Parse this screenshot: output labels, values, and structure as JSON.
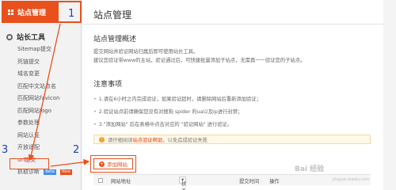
{
  "sidebar": {
    "header": "站点管理",
    "section_title": "站长工具",
    "items": [
      {
        "label": "Sitemap提交"
      },
      {
        "label": "死链提交"
      },
      {
        "label": "域名变更"
      },
      {
        "label": "匹配中文站点名"
      },
      {
        "label": "匹配网站favicon"
      },
      {
        "label": "匹配网站logo"
      },
      {
        "label": "参数处理"
      },
      {
        "label": "网站认证"
      },
      {
        "label": "开放适配"
      },
      {
        "label": "url提交"
      },
      {
        "label": "抓取诊断",
        "tags": [
          "Beta",
          "New"
        ]
      }
    ]
  },
  "main": {
    "title": "站点管理",
    "overview_heading": "站点管理概述",
    "overview_lines": [
      "提交网站并验证网站归属后即可使用站长工具。",
      "建议您验证带www的主站，验证通过后，可快捷批量添加子站点，无需再一一验证您的子站点。"
    ],
    "notes_heading": "注意事项",
    "notes": [
      "1.请在6小时之内完成验证，如果验证超时，请删除网站后重新添加验证；",
      "2.验证站点前请确保您没有对搜狗 spider 的ua以及ip进行封禁；",
      "3.\"添加网站\" 后在表格中点击对应的 \"验证网站\" 进行验证。"
    ],
    "info_prefix": "请仔细阅读",
    "info_link": "站点验证帮助",
    "info_suffix": "，以免造成验证失败",
    "add_button": "添加网站",
    "table_headers": {
      "site": "网站地址",
      "status": "状态",
      "submit_time": "提交时间",
      "action": "操作"
    }
  },
  "annotations": {
    "step1": "1",
    "step2": "2",
    "step3": "3"
  },
  "watermark": {
    "text": "Bai 经验",
    "sub": "jingyan.baidu.com"
  },
  "colors": {
    "accent": "#e8501c",
    "annotation": "#1f3fbf"
  }
}
